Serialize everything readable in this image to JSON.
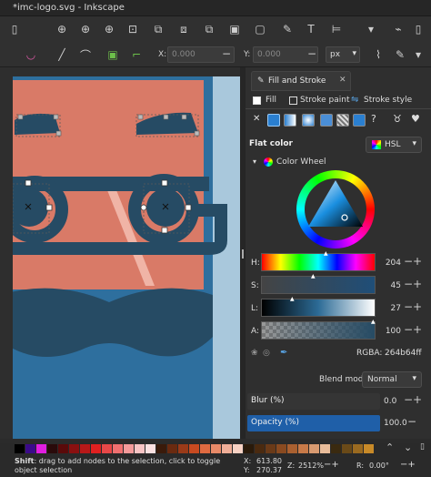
{
  "window": {
    "title": "*imc-logo.svg - Inkscape"
  },
  "toolbar": {
    "x_label": "X:",
    "x_value": "0.000",
    "y_label": "Y:",
    "y_value": "0.000",
    "unit": "px"
  },
  "dock": {
    "panel_title": "Fill and Stroke",
    "tabs": [
      "Fill",
      "Stroke paint",
      "Stroke style"
    ],
    "flat_color_label": "Flat color",
    "color_mode": "HSL",
    "color_wheel_label": "Color Wheel",
    "sliders": [
      {
        "label": "H:",
        "value": "204"
      },
      {
        "label": "S:",
        "value": "45"
      },
      {
        "label": "L:",
        "value": "27"
      },
      {
        "label": "A:",
        "value": "100"
      }
    ],
    "rgba_label": "RGBA:",
    "rgba_value": "264b64ff",
    "blend_label": "Blend mode:",
    "blend_value": "Normal",
    "blur_label": "Blur (%)",
    "blur_value": "0.0",
    "opacity_label": "Opacity (%)",
    "opacity_value": "100.0"
  },
  "status": {
    "message_key": "Shift",
    "message": ": drag to add nodes to the selection, click to toggle object selection",
    "x_label": "X:",
    "x_value": "613.80",
    "y_label": "Y:",
    "y_value": "270.37",
    "zoom_label": "Z:",
    "zoom_value": "2512%",
    "rotate_label": "R:",
    "rotate_value": "0.00°"
  },
  "colors": {
    "selected": "#264b64",
    "face": "#d97a67",
    "beard": "#2e6f9e",
    "glasses": "#264b64",
    "hair": "#264b64",
    "background": "#a9c8dc"
  }
}
